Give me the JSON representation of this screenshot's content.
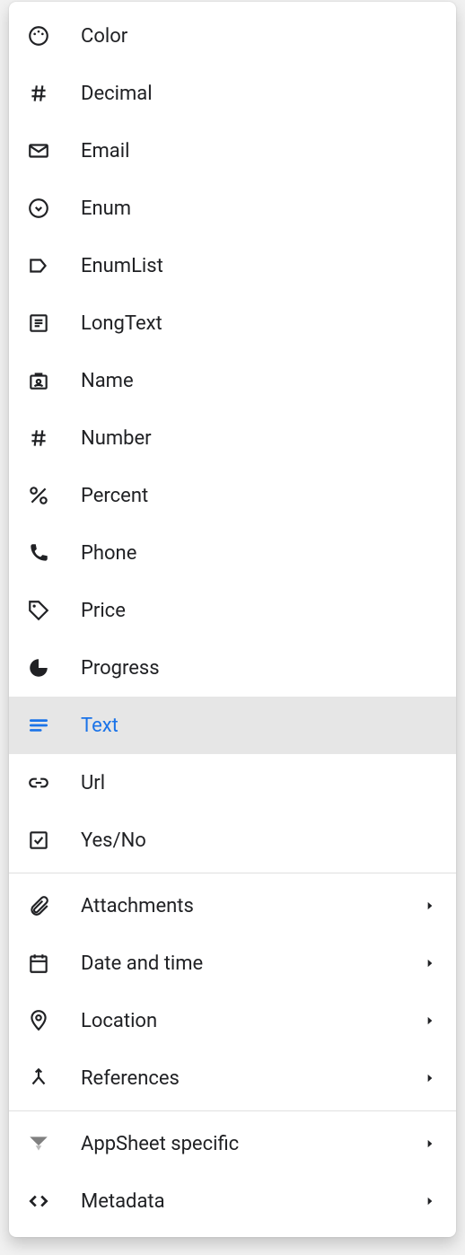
{
  "menu": {
    "group1": [
      {
        "icon": "palette-icon",
        "label": "Color"
      },
      {
        "icon": "hash-icon",
        "label": "Decimal"
      },
      {
        "icon": "mail-icon",
        "label": "Email"
      },
      {
        "icon": "enum-icon",
        "label": "Enum"
      },
      {
        "icon": "tag-icon",
        "label": "EnumList"
      },
      {
        "icon": "longtext-icon",
        "label": "LongText"
      },
      {
        "icon": "badge-icon",
        "label": "Name"
      },
      {
        "icon": "hash-icon",
        "label": "Number"
      },
      {
        "icon": "percent-icon",
        "label": "Percent"
      },
      {
        "icon": "phone-icon",
        "label": "Phone"
      },
      {
        "icon": "price-icon",
        "label": "Price"
      },
      {
        "icon": "progress-icon",
        "label": "Progress"
      },
      {
        "icon": "text-icon",
        "label": "Text",
        "selected": true
      },
      {
        "icon": "link-icon",
        "label": "Url"
      },
      {
        "icon": "checkbox-icon",
        "label": "Yes/No"
      }
    ],
    "group2": [
      {
        "icon": "attach-icon",
        "label": "Attachments"
      },
      {
        "icon": "calendar-icon",
        "label": "Date and time"
      },
      {
        "icon": "location-icon",
        "label": "Location"
      },
      {
        "icon": "merge-icon",
        "label": "References"
      }
    ],
    "group3": [
      {
        "icon": "appsheet-icon",
        "label": "AppSheet specific"
      },
      {
        "icon": "code-icon",
        "label": "Metadata"
      }
    ]
  }
}
